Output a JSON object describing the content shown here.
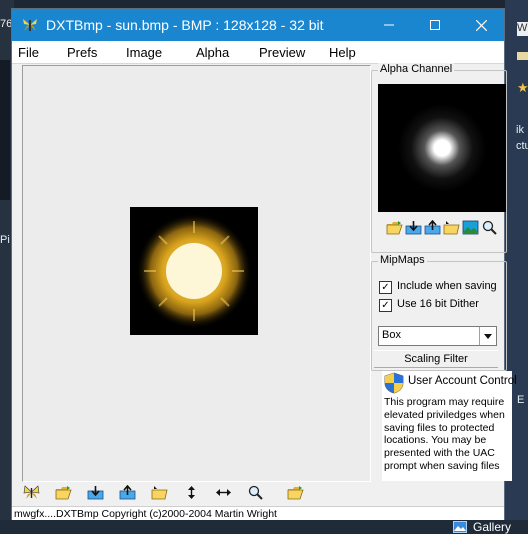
{
  "window": {
    "title": "DXTBmp - sun.bmp - BMP : 128x128 - 32 bit",
    "controls": [
      "minimize",
      "maximize",
      "close"
    ]
  },
  "menu": [
    "File",
    "Prefs",
    "Image",
    "Alpha",
    "Preview",
    "Help"
  ],
  "alpha_channel": {
    "label": "Alpha Channel",
    "toolbar_icons": [
      "open-folder-icon",
      "export-icon",
      "import-icon",
      "folder-arrow-icon",
      "image-edit-icon",
      "zoom-icon"
    ]
  },
  "mipmaps": {
    "label": "MipMaps",
    "include_when_saving": {
      "label": "Include when saving",
      "checked": true
    },
    "use_16bit_dither": {
      "label": "Use 16 bit Dither",
      "checked": true
    },
    "filter_value": "Box",
    "scaling_button": "Scaling Filter"
  },
  "uac": {
    "title": "User Account Control",
    "body": "This program may require elevated priviledges when saving files to protected locations. You may be presented with the UAC prompt when saving files"
  },
  "bottom_toolbar_icons": [
    "butterfly-icon",
    "open-folder-icon",
    "export-icon",
    "import-icon",
    "folder-arrow-icon",
    "vertical-resize-icon",
    "horizontal-resize-icon",
    "zoom-icon",
    "open-folder-icon"
  ],
  "status": "mwgfx....DXTBmp Copyright (c)2000-2004 Martin Wright",
  "background": {
    "left_fragments": [
      "76",
      "Pi"
    ],
    "right_fragments": [
      "W",
      "ik",
      "ctu",
      "E"
    ],
    "taskbar_item": "Gallery"
  },
  "colors": {
    "titlebar": "#1a86d0",
    "sun_core": "#fdf7d8",
    "sun_glow": "#d8a21c"
  }
}
